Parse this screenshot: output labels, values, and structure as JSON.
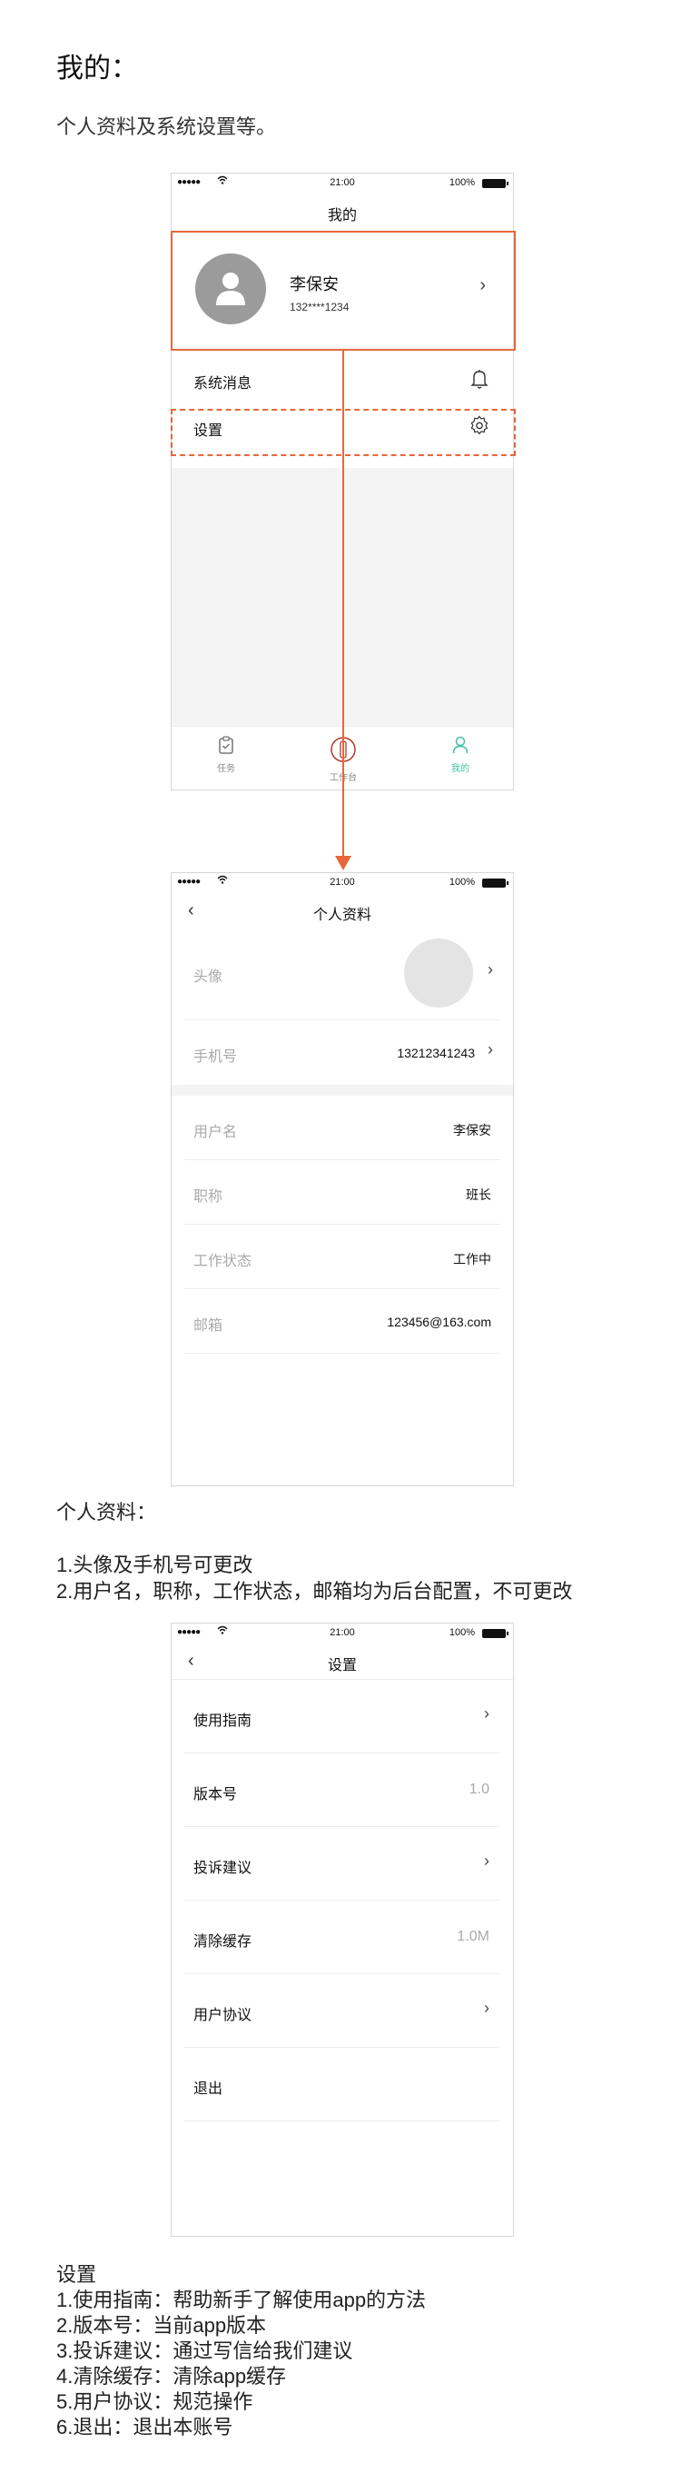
{
  "doc": {
    "title": "我的：",
    "description": "个人资料及系统设置等。"
  },
  "status_bar": {
    "signal": "●●●●●",
    "time": "21:00",
    "battery": "100%"
  },
  "mine_screen": {
    "nav_title": "我的",
    "profile": {
      "name": "李保安",
      "phone": "132****1234"
    },
    "menu": [
      {
        "label": "系统消息",
        "icon": "bell-icon"
      },
      {
        "label": "设置",
        "icon": "gear-icon"
      }
    ],
    "tabs": [
      {
        "label": "任务",
        "icon": "clipboard-icon",
        "active": false
      },
      {
        "label": "工作台",
        "icon": "workbench-icon",
        "active": false
      },
      {
        "label": "我的",
        "icon": "person-icon",
        "active": true
      }
    ]
  },
  "profile_screen": {
    "nav_title": "个人资料",
    "avatar_label": "头像",
    "phone_label": "手机号",
    "phone_value": "13212341243",
    "fields": [
      {
        "label": "用户名",
        "value": "李保安"
      },
      {
        "label": "职称",
        "value": "班长"
      },
      {
        "label": "工作状态",
        "value": "工作中"
      },
      {
        "label": "邮箱",
        "value": "123456@163.com"
      }
    ]
  },
  "profile_note": {
    "title": "个人资料：",
    "lines": [
      "1.头像及手机号可更改",
      "2.用户名，职称，工作状态，邮箱均为后台配置，不可更改"
    ]
  },
  "settings_screen": {
    "nav_title": "设置",
    "rows": [
      {
        "label": "使用指南",
        "value": "",
        "chevron": true
      },
      {
        "label": "版本号",
        "value": "1.0",
        "chevron": false
      },
      {
        "label": "投诉建议",
        "value": "",
        "chevron": true
      },
      {
        "label": "清除缓存",
        "value": "1.0M",
        "chevron": false
      },
      {
        "label": "用户协议",
        "value": "",
        "chevron": true
      },
      {
        "label": "退出",
        "value": "",
        "chevron": false
      }
    ]
  },
  "settings_note": {
    "title": "设置",
    "lines": [
      "1.使用指南：帮助新手了解使用app的方法",
      "2.版本号：当前app版本",
      "3.投诉建议：通过写信给我们建议",
      "4.清除缓存：清除app缓存",
      "5.用户协议：规范操作",
      "6.退出：退出本账号"
    ]
  },
  "colors": {
    "annotation": "#e8673a",
    "active_tab": "#3dc2a1",
    "avatar": "#9b9b9b",
    "background_gray": "#f4f4f4"
  }
}
